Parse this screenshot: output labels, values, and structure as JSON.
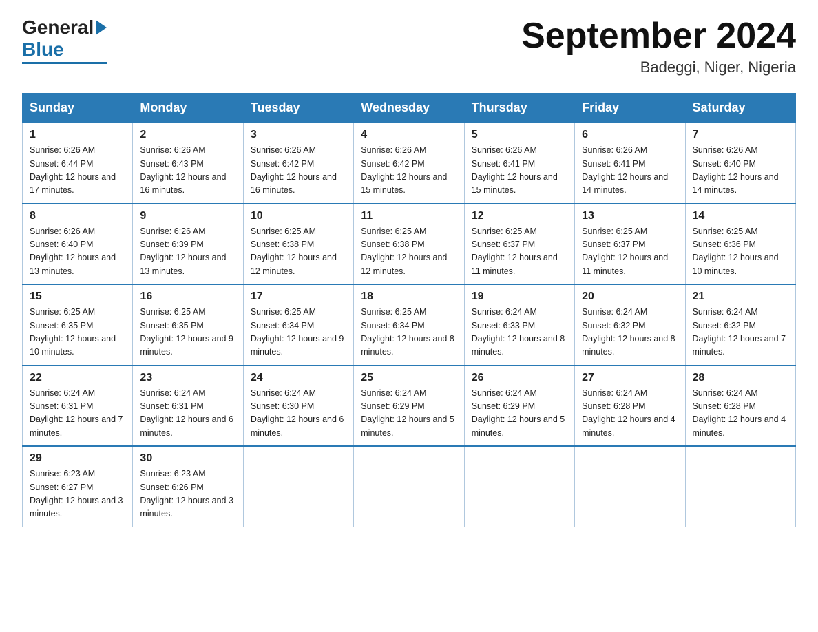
{
  "header": {
    "logo_general": "General",
    "logo_blue": "Blue",
    "title": "September 2024",
    "subtitle": "Badeggi, Niger, Nigeria"
  },
  "columns": [
    "Sunday",
    "Monday",
    "Tuesday",
    "Wednesday",
    "Thursday",
    "Friday",
    "Saturday"
  ],
  "weeks": [
    [
      {
        "day": "1",
        "sunrise": "Sunrise: 6:26 AM",
        "sunset": "Sunset: 6:44 PM",
        "daylight": "Daylight: 12 hours and 17 minutes."
      },
      {
        "day": "2",
        "sunrise": "Sunrise: 6:26 AM",
        "sunset": "Sunset: 6:43 PM",
        "daylight": "Daylight: 12 hours and 16 minutes."
      },
      {
        "day": "3",
        "sunrise": "Sunrise: 6:26 AM",
        "sunset": "Sunset: 6:42 PM",
        "daylight": "Daylight: 12 hours and 16 minutes."
      },
      {
        "day": "4",
        "sunrise": "Sunrise: 6:26 AM",
        "sunset": "Sunset: 6:42 PM",
        "daylight": "Daylight: 12 hours and 15 minutes."
      },
      {
        "day": "5",
        "sunrise": "Sunrise: 6:26 AM",
        "sunset": "Sunset: 6:41 PM",
        "daylight": "Daylight: 12 hours and 15 minutes."
      },
      {
        "day": "6",
        "sunrise": "Sunrise: 6:26 AM",
        "sunset": "Sunset: 6:41 PM",
        "daylight": "Daylight: 12 hours and 14 minutes."
      },
      {
        "day": "7",
        "sunrise": "Sunrise: 6:26 AM",
        "sunset": "Sunset: 6:40 PM",
        "daylight": "Daylight: 12 hours and 14 minutes."
      }
    ],
    [
      {
        "day": "8",
        "sunrise": "Sunrise: 6:26 AM",
        "sunset": "Sunset: 6:40 PM",
        "daylight": "Daylight: 12 hours and 13 minutes."
      },
      {
        "day": "9",
        "sunrise": "Sunrise: 6:26 AM",
        "sunset": "Sunset: 6:39 PM",
        "daylight": "Daylight: 12 hours and 13 minutes."
      },
      {
        "day": "10",
        "sunrise": "Sunrise: 6:25 AM",
        "sunset": "Sunset: 6:38 PM",
        "daylight": "Daylight: 12 hours and 12 minutes."
      },
      {
        "day": "11",
        "sunrise": "Sunrise: 6:25 AM",
        "sunset": "Sunset: 6:38 PM",
        "daylight": "Daylight: 12 hours and 12 minutes."
      },
      {
        "day": "12",
        "sunrise": "Sunrise: 6:25 AM",
        "sunset": "Sunset: 6:37 PM",
        "daylight": "Daylight: 12 hours and 11 minutes."
      },
      {
        "day": "13",
        "sunrise": "Sunrise: 6:25 AM",
        "sunset": "Sunset: 6:37 PM",
        "daylight": "Daylight: 12 hours and 11 minutes."
      },
      {
        "day": "14",
        "sunrise": "Sunrise: 6:25 AM",
        "sunset": "Sunset: 6:36 PM",
        "daylight": "Daylight: 12 hours and 10 minutes."
      }
    ],
    [
      {
        "day": "15",
        "sunrise": "Sunrise: 6:25 AM",
        "sunset": "Sunset: 6:35 PM",
        "daylight": "Daylight: 12 hours and 10 minutes."
      },
      {
        "day": "16",
        "sunrise": "Sunrise: 6:25 AM",
        "sunset": "Sunset: 6:35 PM",
        "daylight": "Daylight: 12 hours and 9 minutes."
      },
      {
        "day": "17",
        "sunrise": "Sunrise: 6:25 AM",
        "sunset": "Sunset: 6:34 PM",
        "daylight": "Daylight: 12 hours and 9 minutes."
      },
      {
        "day": "18",
        "sunrise": "Sunrise: 6:25 AM",
        "sunset": "Sunset: 6:34 PM",
        "daylight": "Daylight: 12 hours and 8 minutes."
      },
      {
        "day": "19",
        "sunrise": "Sunrise: 6:24 AM",
        "sunset": "Sunset: 6:33 PM",
        "daylight": "Daylight: 12 hours and 8 minutes."
      },
      {
        "day": "20",
        "sunrise": "Sunrise: 6:24 AM",
        "sunset": "Sunset: 6:32 PM",
        "daylight": "Daylight: 12 hours and 8 minutes."
      },
      {
        "day": "21",
        "sunrise": "Sunrise: 6:24 AM",
        "sunset": "Sunset: 6:32 PM",
        "daylight": "Daylight: 12 hours and 7 minutes."
      }
    ],
    [
      {
        "day": "22",
        "sunrise": "Sunrise: 6:24 AM",
        "sunset": "Sunset: 6:31 PM",
        "daylight": "Daylight: 12 hours and 7 minutes."
      },
      {
        "day": "23",
        "sunrise": "Sunrise: 6:24 AM",
        "sunset": "Sunset: 6:31 PM",
        "daylight": "Daylight: 12 hours and 6 minutes."
      },
      {
        "day": "24",
        "sunrise": "Sunrise: 6:24 AM",
        "sunset": "Sunset: 6:30 PM",
        "daylight": "Daylight: 12 hours and 6 minutes."
      },
      {
        "day": "25",
        "sunrise": "Sunrise: 6:24 AM",
        "sunset": "Sunset: 6:29 PM",
        "daylight": "Daylight: 12 hours and 5 minutes."
      },
      {
        "day": "26",
        "sunrise": "Sunrise: 6:24 AM",
        "sunset": "Sunset: 6:29 PM",
        "daylight": "Daylight: 12 hours and 5 minutes."
      },
      {
        "day": "27",
        "sunrise": "Sunrise: 6:24 AM",
        "sunset": "Sunset: 6:28 PM",
        "daylight": "Daylight: 12 hours and 4 minutes."
      },
      {
        "day": "28",
        "sunrise": "Sunrise: 6:24 AM",
        "sunset": "Sunset: 6:28 PM",
        "daylight": "Daylight: 12 hours and 4 minutes."
      }
    ],
    [
      {
        "day": "29",
        "sunrise": "Sunrise: 6:23 AM",
        "sunset": "Sunset: 6:27 PM",
        "daylight": "Daylight: 12 hours and 3 minutes."
      },
      {
        "day": "30",
        "sunrise": "Sunrise: 6:23 AM",
        "sunset": "Sunset: 6:26 PM",
        "daylight": "Daylight: 12 hours and 3 minutes."
      },
      null,
      null,
      null,
      null,
      null
    ]
  ]
}
